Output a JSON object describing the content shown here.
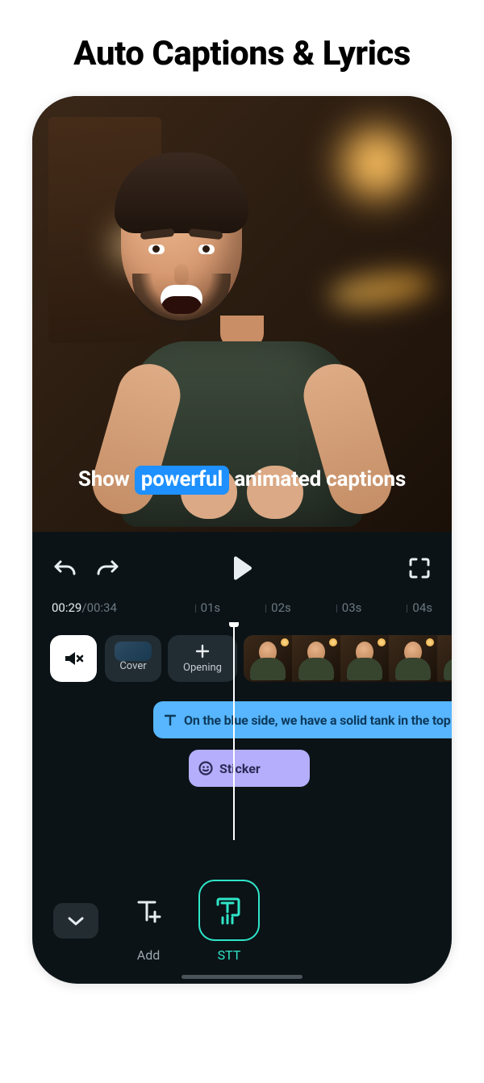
{
  "page_title": "Auto Captions & Lyrics",
  "preview": {
    "caption_pre": "Show ",
    "caption_highlight": "powerful",
    "caption_post": " animated captions"
  },
  "transport": {
    "undo_icon": "undo-icon",
    "redo_icon": "redo-icon",
    "play_icon": "play-icon",
    "expand_icon": "expand-icon"
  },
  "ruler": {
    "current": "00:29",
    "separator": " / ",
    "total": "00:34",
    "ticks": [
      "01s",
      "02s",
      "03s",
      "04s"
    ]
  },
  "timeline": {
    "mute_icon": "mute-icon",
    "cover_label": "Cover",
    "opening_label": "Opening",
    "caption_track_text": "On the blue side,  we have a solid tank in the top l",
    "sticker_track_text": "Sticker"
  },
  "toolbar": {
    "collapse_icon": "chevron-down-icon",
    "tools": [
      {
        "id": "add",
        "label": "Add",
        "active": false
      },
      {
        "id": "stt",
        "label": "STT",
        "active": true
      }
    ]
  }
}
